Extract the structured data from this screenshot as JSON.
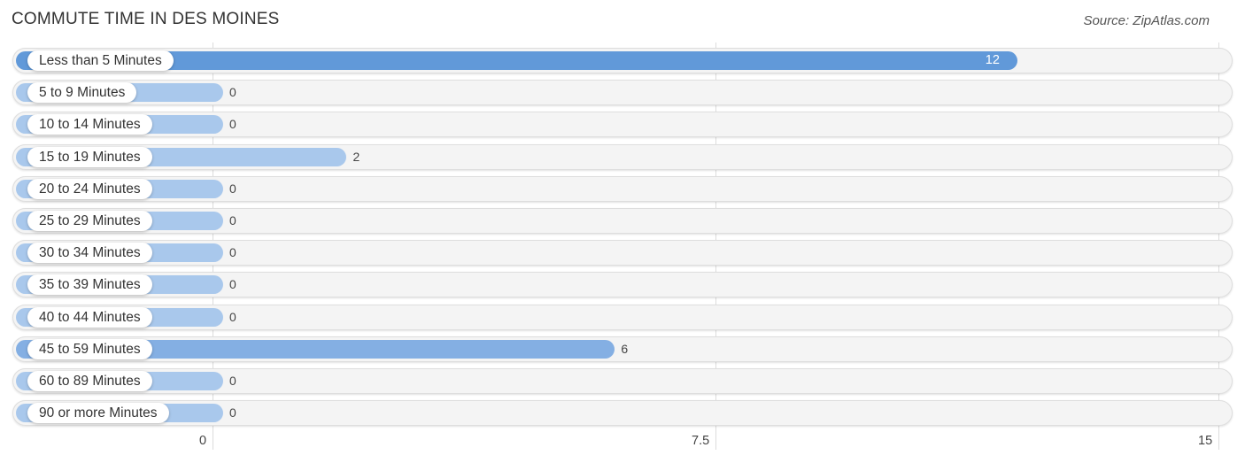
{
  "chart_data": {
    "type": "bar",
    "orientation": "horizontal",
    "title": "COMMUTE TIME IN DES MOINES",
    "source": "Source: ZipAtlas.com",
    "categories": [
      "Less than 5 Minutes",
      "5 to 9 Minutes",
      "10 to 14 Minutes",
      "15 to 19 Minutes",
      "20 to 24 Minutes",
      "25 to 29 Minutes",
      "30 to 34 Minutes",
      "35 to 39 Minutes",
      "40 to 44 Minutes",
      "45 to 59 Minutes",
      "60 to 89 Minutes",
      "90 or more Minutes"
    ],
    "values": [
      12,
      0,
      0,
      2,
      0,
      0,
      0,
      0,
      0,
      6,
      0,
      0
    ],
    "value_labels": [
      "12",
      "0",
      "0",
      "2",
      "0",
      "0",
      "0",
      "0",
      "0",
      "6",
      "0",
      "0"
    ],
    "xlim": [
      0,
      15
    ],
    "xticks": [
      0,
      7.5,
      15
    ],
    "xtick_labels": [
      "0",
      "7.5",
      "15"
    ],
    "xlabel": "",
    "ylabel": "",
    "grid": true,
    "legend": "none",
    "colors": {
      "max_bar": "#6199d9",
      "bar": "#a9c8ec",
      "bar_mid": "#84afe3",
      "track": "#f4f4f4",
      "grid": "#dcdcdc"
    }
  }
}
